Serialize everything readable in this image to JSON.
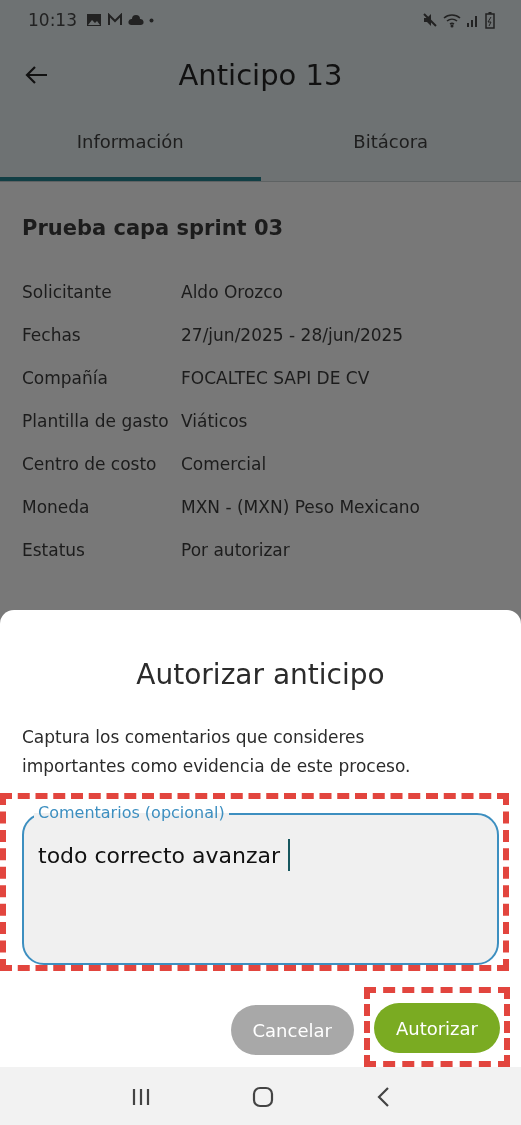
{
  "status_bar": {
    "time": "10:13"
  },
  "app_bar": {
    "title": "Anticipo 13"
  },
  "tabs": [
    {
      "label": "Información",
      "selected": true
    },
    {
      "label": "Bitácora",
      "selected": false
    }
  ],
  "details": {
    "title": "Prueba capa sprint 03",
    "rows": [
      {
        "label": "Solicitante",
        "value": "Aldo Orozco"
      },
      {
        "label": "Fechas",
        "value": "27/jun/2025 - 28/jun/2025"
      },
      {
        "label": "Compañía",
        "value": "FOCALTEC SAPI DE CV"
      },
      {
        "label": "Plantilla de gasto",
        "value": "Viáticos"
      },
      {
        "label": "Centro de costo",
        "value": "Comercial"
      },
      {
        "label": "Moneda",
        "value": "MXN - (MXN) Peso Mexicano"
      },
      {
        "label": "Estatus",
        "value": "Por autorizar"
      }
    ]
  },
  "dialog": {
    "title": "Autorizar anticipo",
    "message": "Captura los comentarios que consideres importantes como evidencia de este proceso.",
    "comment_field": {
      "label": "Comentarios (opcional)",
      "value": "todo correcto avanzar",
      "focused": true,
      "highlighted": true
    },
    "buttons": [
      {
        "label": "Cancelar",
        "kind": "secondary",
        "disabled": true,
        "highlighted": false
      },
      {
        "label": "Autorizar",
        "kind": "primary",
        "disabled": false,
        "highlighted": true
      }
    ]
  }
}
